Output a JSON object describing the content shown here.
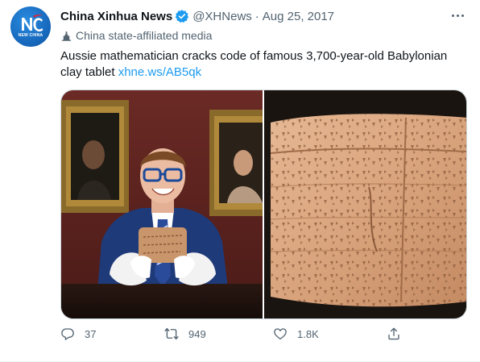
{
  "tweet": {
    "author_name": "China Xinhua News",
    "handle": "@XHNews",
    "separator": "·",
    "date": "Aug 25, 2017",
    "avatar_caption": "NEW CHINA",
    "affiliation_label": "China state-affiliated media",
    "text_body": "Aussie mathematician cracks code of famous 3,700-year-old Babylonian clay tablet ",
    "link_text": "xhne.ws/AB5qk",
    "media": [
      {
        "icon": "photo-man-with-tablet"
      },
      {
        "icon": "photo-clay-tablet-closeup"
      }
    ],
    "actions": {
      "reply_count": "37",
      "retweet_count": "949",
      "like_count": "1.8K"
    }
  },
  "colors": {
    "accent": "#1d9bf0",
    "text": "#0f1419",
    "secondary_text": "#536471",
    "border": "#cfd9de",
    "avatar_bg": "#1565b8"
  }
}
